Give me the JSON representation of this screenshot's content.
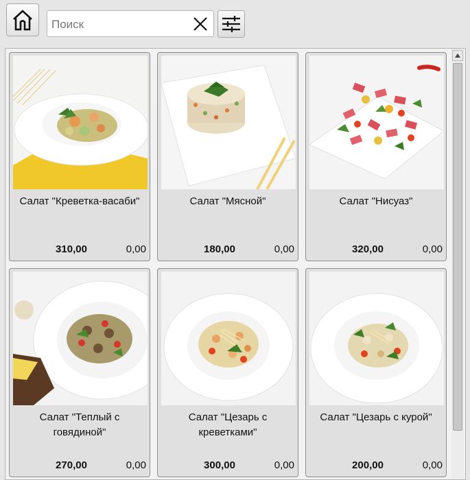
{
  "toolbar": {
    "home_icon": "home-icon",
    "search": {
      "placeholder": "Поиск",
      "value": ""
    },
    "clear_icon": "close-icon",
    "filter_icon": "sliders-icon"
  },
  "products": [
    {
      "name": "Салат \"Креветка-васаби\"",
      "price": "310,00",
      "qty": "0,00"
    },
    {
      "name": "Салат \"Мясной\"",
      "price": "180,00",
      "qty": "0,00"
    },
    {
      "name": "Салат \"Нисуаз\"",
      "price": "320,00",
      "qty": "0,00"
    },
    {
      "name": "Салат \"Теплый с говядиной\"",
      "price": "270,00",
      "qty": "0,00"
    },
    {
      "name": "Салат \"Цезарь с креветками\"",
      "price": "300,00",
      "qty": "0,00"
    },
    {
      "name": "Салат \"Цезарь с курой\"",
      "price": "200,00",
      "qty": "0,00"
    }
  ],
  "colors": {
    "background": "#e6e6e6",
    "card": "#e0e0e0",
    "accent_yellow": "#f2cc2e"
  }
}
